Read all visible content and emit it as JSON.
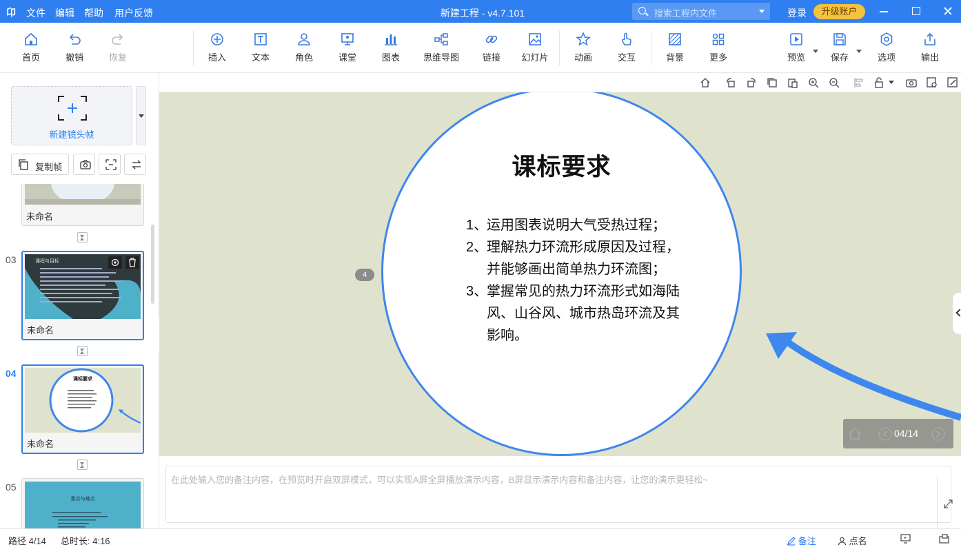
{
  "app": {
    "logo": "卬",
    "title": "新建工程 - v4.7.101"
  },
  "menu": [
    "文件",
    "编辑",
    "帮助",
    "用户反馈"
  ],
  "search": {
    "placeholder": "搜索工程内文件"
  },
  "account": {
    "login": "登录",
    "upgrade": "升级账户"
  },
  "toolbar": {
    "home": "首页",
    "undo": "撤销",
    "redo": "恢复",
    "insert": "插入",
    "text": "文本",
    "role": "角色",
    "classroom": "课堂",
    "chart": "图表",
    "mindmap": "思维导图",
    "link": "链接",
    "slides": "幻灯片",
    "animation": "动画",
    "interaction": "交互",
    "background": "背景",
    "more": "更多",
    "preview": "预览",
    "save": "保存",
    "options": "选项",
    "export": "输出"
  },
  "sidebar": {
    "new_frame": "新建镜头帧",
    "copy_frame": "复制帧",
    "slides": [
      {
        "num": "",
        "name": "未命名"
      },
      {
        "num": "03",
        "name": "未命名",
        "thumb_title": "课程与目标"
      },
      {
        "num": "04",
        "name": "未命名",
        "thumb_title": "课标要求"
      },
      {
        "num": "05",
        "name": "",
        "thumb_title": "重点与难点"
      }
    ]
  },
  "slide": {
    "title": "课标要求",
    "items": [
      {
        "n": "1、",
        "text": "运用图表说明大气受热过程；"
      },
      {
        "n": "2、",
        "text": "理解热力环流形成原因及过程，并能够画出简单热力环流图；"
      },
      {
        "n": "3、",
        "text": "掌握常见的热力环流形式如海陆风、山谷风、城市热岛环流及其影响。"
      }
    ],
    "badge": "4",
    "page_indicator": "04/14"
  },
  "notes": {
    "placeholder": "在此处输入您的备注内容，在预览时开启双屏模式，可以实现A屏全屏播放演示内容，B屏显示演示内容和备注内容，让您的演示更轻松~"
  },
  "status": {
    "path": "路径 4/14",
    "duration": "总时长: 4:16",
    "notes_tab": "备注",
    "rollcall": "点名"
  },
  "colors": {
    "accent": "#2f7ff0",
    "upgrade": "#f6c23d",
    "stage_bg": "#dfe3cd",
    "circle_border": "#3e87ee"
  }
}
